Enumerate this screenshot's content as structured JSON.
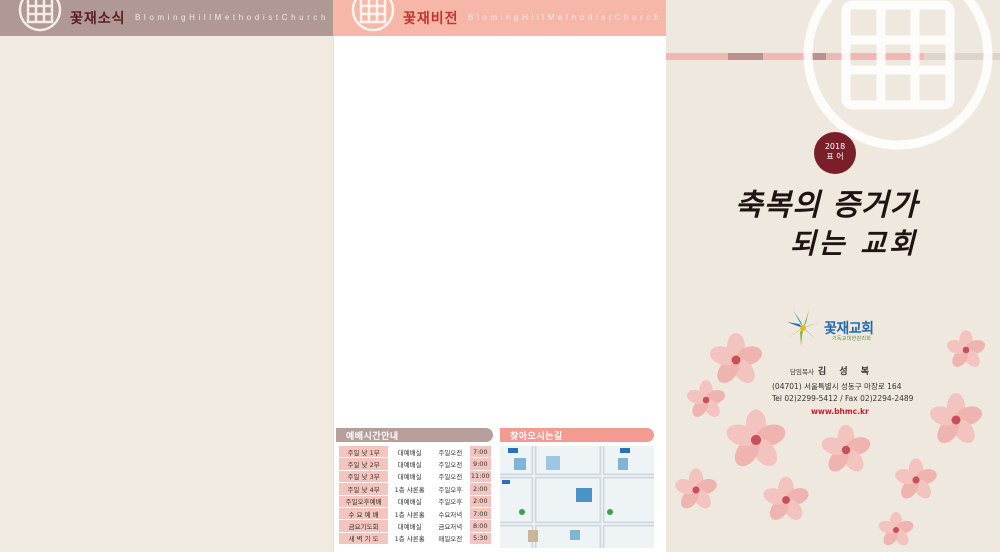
{
  "panel_news": {
    "title": "꽃재소식",
    "subtitle": "BlomingHillMethodistChurch"
  },
  "panel_vision": {
    "title": "꽃재비전",
    "subtitle": "BlomingHillMethodistChurch"
  },
  "worship": {
    "heading": "예배시간안내",
    "rows": [
      {
        "name": "주일 낮 1부",
        "place": "대예배실",
        "day": "주일오전",
        "time": "7:00"
      },
      {
        "name": "주일 낮 2부",
        "place": "대예배실",
        "day": "주일오전",
        "time": "9:00"
      },
      {
        "name": "주일 낮 3부",
        "place": "대예배실",
        "day": "주일오전",
        "time": "11:00"
      },
      {
        "name": "주일 낮 4부",
        "place": "1층 샤론홀",
        "day": "주일오후",
        "time": "2:00"
      },
      {
        "name": "주일오후예배",
        "place": "대예배실",
        "day": "주일오후",
        "time": "2:00"
      },
      {
        "name": "수 요 예 배",
        "place": "1층 샤론홀",
        "day": "수요저녁",
        "time": "7:00"
      },
      {
        "name": "금요기도회",
        "place": "대예배실",
        "day": "금요저녁",
        "time": "8:00"
      },
      {
        "name": "새 벽 기 도",
        "place": "1층 샤론홀",
        "day": "매일오전",
        "time": "5:30"
      }
    ]
  },
  "directions": {
    "heading": "찾아오시는길"
  },
  "cover": {
    "badge_year": "2018",
    "badge_label": "표 어",
    "title_line1": "축복의 증거가",
    "title_line2": "되는 교회",
    "church_name": "꽃재교회",
    "church_sub": "기독교대한감리회",
    "pastor_label": "담임목사",
    "pastor_name": "김 성 복",
    "address": "(04701) 서울특별시 성동구 마장로 164",
    "tel": "Tel 02)2299-5412 / Fax 02)2294-2489",
    "website": "www.bhmc.kr"
  },
  "colors": {
    "news_header": "#b09894",
    "vision_header": "#f7b7a8",
    "accent_maroon": "#7a1f2a",
    "link_red": "#cc1d2a"
  }
}
